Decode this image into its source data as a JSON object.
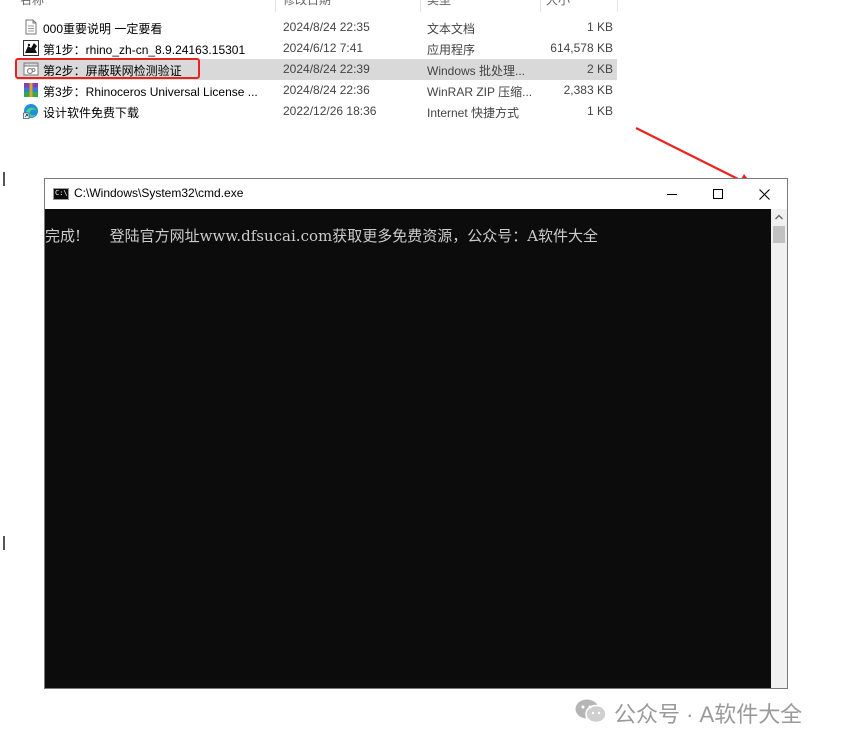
{
  "explorer": {
    "columns": {
      "name": "名称",
      "date": "修改日期",
      "type": "类型",
      "size": "大小"
    },
    "files": [
      {
        "name": "000重要说明 一定要看",
        "date": "2024/8/24 22:35",
        "type": "文本文档",
        "size": "1 KB",
        "icon": "text-file-icon"
      },
      {
        "name": "第1步：rhino_zh-cn_8.9.24163.15301",
        "date": "2024/6/12 7:41",
        "type": "应用程序",
        "size": "614,578 KB",
        "icon": "rhino-app-icon"
      },
      {
        "name": "第2步：屏蔽联网检测验证",
        "date": "2024/8/24 22:39",
        "type": "Windows 批处理...",
        "size": "2 KB",
        "icon": "batch-file-icon"
      },
      {
        "name": "第3步：Rhinoceros Universal License ...",
        "date": "2024/8/24 22:36",
        "type": "WinRAR ZIP 压缩...",
        "size": "2,383 KB",
        "icon": "winrar-zip-icon"
      },
      {
        "name": "设计软件免费下载",
        "date": "2022/12/26 18:36",
        "type": "Internet 快捷方式",
        "size": "1 KB",
        "icon": "edge-shortcut-icon"
      }
    ],
    "selected_index": 2
  },
  "cmd": {
    "title": "C:\\Windows\\System32\\cmd.exe",
    "output": "完成!      登陆官方网址www.dfsucai.com获取更多免费资源，公众号：A软件大全",
    "prompt_glyph": "C:\\"
  },
  "watermark": {
    "text": "公众号 · A软件大全"
  },
  "colors": {
    "annotation_red": "#e8231f",
    "console_bg": "#0c0c0c",
    "console_text": "#cccccc",
    "selected_row": "#d9d9d9"
  }
}
